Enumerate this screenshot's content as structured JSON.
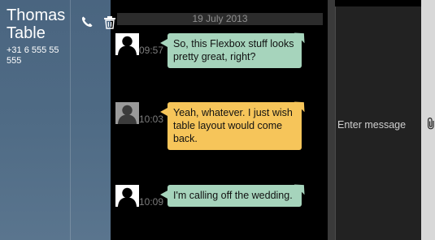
{
  "contact": {
    "name": "Thomas Table",
    "phone": "+31 6 555 55 555"
  },
  "icons": {
    "call": "phone-icon",
    "delete": "trash-icon",
    "attach": "paperclip-icon",
    "avatar": "person-silhouette-icon"
  },
  "conversation": {
    "date": "19 July 2013",
    "messages": [
      {
        "time": "09:57",
        "text": "So, this Flexbox stuff looks pretty great, right?",
        "color": "#a6d4bc"
      },
      {
        "time": "10:03",
        "text": "Yeah, whatever. I just wish table layout would come back.",
        "color": "#f6c55a"
      },
      {
        "time": "10:09",
        "text": "I'm calling off the wedding.",
        "color": "#a6d4bc"
      }
    ]
  },
  "compose": {
    "placeholder": "Enter message"
  }
}
